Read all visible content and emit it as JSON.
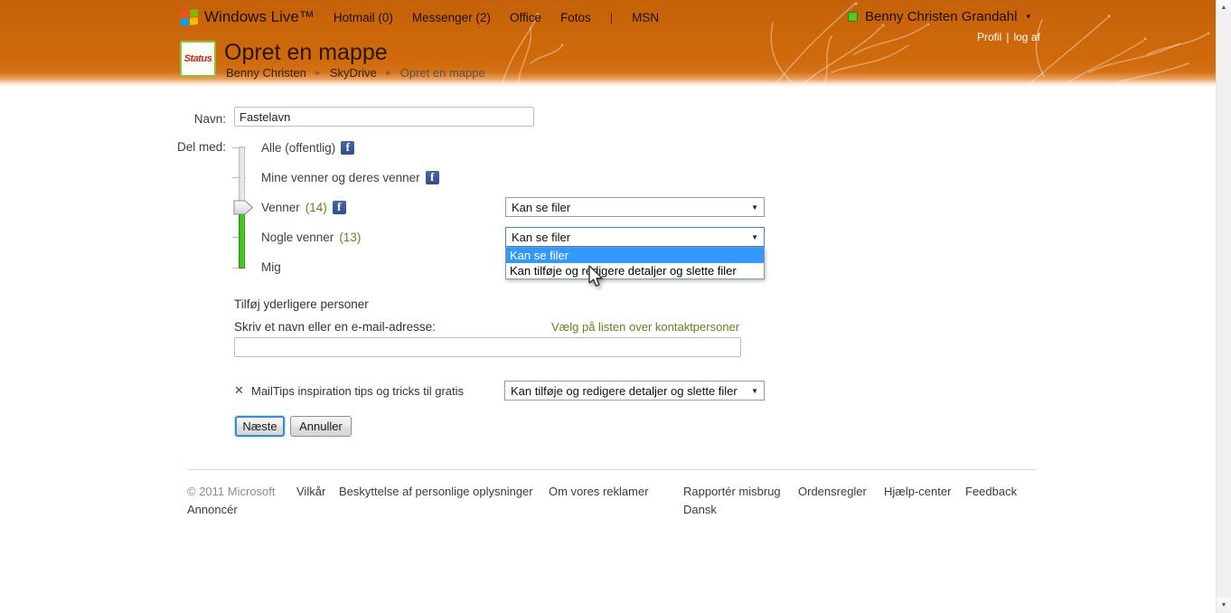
{
  "icons": {
    "select_arrow": "▼",
    "breadcrumb_arrow": "►",
    "facebook_f": "f",
    "user_caret": "▾",
    "remove_x": "✕",
    "scroll_up": "▲",
    "scroll_down": "▼"
  },
  "colors": {
    "header_orange": "#cb660a",
    "olive_link": "#697d1e",
    "slider_green": "#3db51c",
    "facebook_blue": "#3a579a",
    "selection_blue": "#3399ff"
  },
  "header": {
    "brand": "Windows Live™",
    "nav": [
      {
        "label": "Hotmail (0)"
      },
      {
        "label": "Messenger (2)"
      },
      {
        "label": "Office"
      },
      {
        "label": "Fotos"
      },
      {
        "label": "MSN"
      }
    ],
    "nav_separator": "|",
    "user": {
      "name": "Benny Christen Grandahl",
      "profil": "Profil",
      "separator": "|",
      "logoff": "log af"
    },
    "avatar_text": "Status",
    "title": "Opret en mappe",
    "breadcrumb": {
      "items": [
        "Benny Christen",
        "SkyDrive",
        "Opret en mappe"
      ],
      "separator": "►"
    }
  },
  "form": {
    "name_label": "Navn:",
    "name_value": "Fastelavn",
    "share_label": "Del med:",
    "share_levels": [
      {
        "label": "Alle (offentlig)",
        "count": ""
      },
      {
        "label": "Mine venner og deres venner",
        "count": ""
      },
      {
        "label": "Venner",
        "count": "(14)"
      },
      {
        "label": "Nogle venner",
        "count": "(13)"
      },
      {
        "label": "Mig",
        "count": ""
      }
    ],
    "venner_permission": {
      "value": "Kan se filer"
    },
    "nogle_permission": {
      "value": "Kan se filer",
      "options": [
        "Kan se filer",
        "Kan tilføje og redigere detaljer og slette filer"
      ],
      "selected": "Kan se filer"
    },
    "add_people": {
      "heading": "Tilføj yderligere personer",
      "input_label": "Skriv et navn eller en e-mail-adresse:",
      "contacts_link": "Vælg på listen over kontaktpersoner",
      "input_value": ""
    },
    "mailtips": {
      "label": "MailTips inspiration tips og tricks til gratis",
      "permission_value": "Kan tilføje og redigere detaljer og slette filer"
    },
    "buttons": {
      "next": "Næste",
      "cancel": "Annuller"
    }
  },
  "footer": {
    "row1": [
      "© 2011 Microsoft",
      "Vilkår",
      "Beskyttelse af personlige oplysninger",
      "Om vores reklamer",
      "Rapportér misbrug",
      "Ordensregler",
      "Hjælp-center",
      "Feedback"
    ],
    "row2": [
      "Annoncér",
      "Dansk"
    ]
  }
}
